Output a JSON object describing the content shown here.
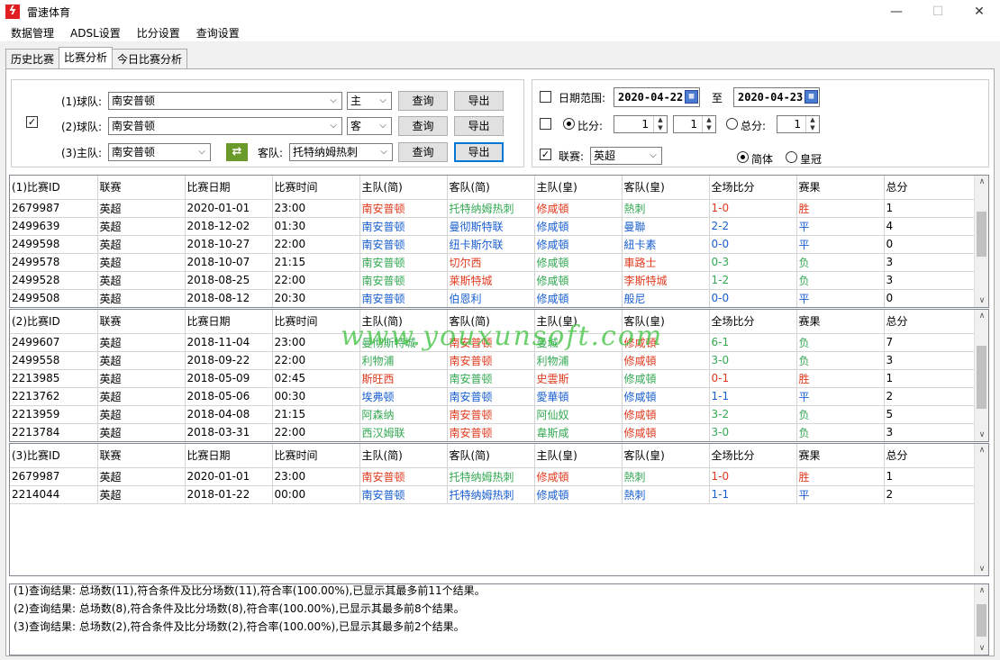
{
  "window": {
    "title": "雷速体育",
    "app_icon": "lightning-app-icon",
    "minimize": "—",
    "maximize": "☐",
    "close": "✕"
  },
  "menu": [
    "数据管理",
    "ADSL设置",
    "比分设置",
    "查询设置"
  ],
  "tabs": [
    "历史比赛",
    "比赛分析",
    "今日比赛分析"
  ],
  "active_tab": "比赛分析",
  "query": {
    "row1": {
      "label": "(1)球队:",
      "team": "南安普顿",
      "side": "主",
      "query_btn": "查询",
      "export_btn": "导出"
    },
    "row2": {
      "label": "(2)球队:",
      "team": "南安普顿",
      "side": "客",
      "query_btn": "查询",
      "export_btn": "导出"
    },
    "row3": {
      "label": "(3)主队:",
      "home": "南安普顿",
      "away_label": "客队:",
      "away": "托特纳姆热刺",
      "query_btn": "查询",
      "export_btn": "导出"
    },
    "checked": true
  },
  "filters": {
    "date_range_label": "日期范围:",
    "date_from": "2020-04-22",
    "to_label": "至",
    "date_to": "2020-04-23",
    "score_label": "比分:",
    "score_home": "1",
    "score_sep": ":",
    "score_away": "1",
    "total_label": "总分:",
    "total_value": "1",
    "league_label": "联赛:",
    "league": "英超",
    "simplified_label": "简体",
    "crown_label": "皇冠",
    "date_checked": false,
    "score_checked": false,
    "league_checked": true
  },
  "grid1": {
    "headers": [
      "(1)比赛ID",
      "联赛",
      "比赛日期",
      "比赛时间",
      "主队(简)",
      "客队(简)",
      "主队(皇)",
      "客队(皇)",
      "全场比分",
      "赛果",
      "总分"
    ],
    "rows": [
      [
        "2679987",
        "英超",
        "2020-01-01",
        "23:00",
        "南安普顿",
        "托特纳姆热刺",
        "修咸頓",
        "熱刺",
        "1-0",
        "胜",
        "1"
      ],
      [
        "2499639",
        "英超",
        "2018-12-02",
        "01:30",
        "南安普顿",
        "曼彻斯特联",
        "修咸頓",
        "曼聯",
        "2-2",
        "平",
        "4"
      ],
      [
        "2499598",
        "英超",
        "2018-10-27",
        "22:00",
        "南安普顿",
        "纽卡斯尔联",
        "修咸頓",
        "紐卡素",
        "0-0",
        "平",
        "0"
      ],
      [
        "2499578",
        "英超",
        "2018-10-07",
        "21:15",
        "南安普顿",
        "切尔西",
        "修咸頓",
        "車路士",
        "0-3",
        "负",
        "3"
      ],
      [
        "2499528",
        "英超",
        "2018-08-25",
        "22:00",
        "南安普顿",
        "莱斯特城",
        "修咸頓",
        "李斯特城",
        "1-2",
        "负",
        "3"
      ],
      [
        "2499508",
        "英超",
        "2018-08-12",
        "20:30",
        "南安普顿",
        "伯恩利",
        "修咸頓",
        "般尼",
        "0-0",
        "平",
        "0"
      ]
    ]
  },
  "grid2": {
    "headers": [
      "(2)比赛ID",
      "联赛",
      "比赛日期",
      "比赛时间",
      "主队(简)",
      "客队(简)",
      "主队(皇)",
      "客队(皇)",
      "全场比分",
      "赛果",
      "总分"
    ],
    "rows": [
      [
        "2499607",
        "英超",
        "2018-11-04",
        "23:00",
        "曼彻斯特城",
        "南安普顿",
        "曼城",
        "修咸頓",
        "6-1",
        "负",
        "7"
      ],
      [
        "2499558",
        "英超",
        "2018-09-22",
        "22:00",
        "利物浦",
        "南安普顿",
        "利物浦",
        "修咸頓",
        "3-0",
        "负",
        "3"
      ],
      [
        "2213985",
        "英超",
        "2018-05-09",
        "02:45",
        "斯旺西",
        "南安普顿",
        "史雲斯",
        "修咸頓",
        "0-1",
        "胜",
        "1"
      ],
      [
        "2213762",
        "英超",
        "2018-05-06",
        "00:30",
        "埃弗顿",
        "南安普顿",
        "愛華頓",
        "修咸頓",
        "1-1",
        "平",
        "2"
      ],
      [
        "2213959",
        "英超",
        "2018-04-08",
        "21:15",
        "阿森纳",
        "南安普顿",
        "阿仙奴",
        "修咸頓",
        "3-2",
        "负",
        "5"
      ],
      [
        "2213784",
        "英超",
        "2018-03-31",
        "22:00",
        "西汉姆联",
        "南安普顿",
        "韋斯咸",
        "修咸頓",
        "3-0",
        "负",
        "3"
      ]
    ]
  },
  "grid3": {
    "headers": [
      "(3)比赛ID",
      "联赛",
      "比赛日期",
      "比赛时间",
      "主队(简)",
      "客队(简)",
      "主队(皇)",
      "客队(皇)",
      "全场比分",
      "赛果",
      "总分"
    ],
    "rows": [
      [
        "2679987",
        "英超",
        "2020-01-01",
        "23:00",
        "南安普顿",
        "托特纳姆热刺",
        "修咸頓",
        "熱刺",
        "1-0",
        "胜",
        "1"
      ],
      [
        "2214044",
        "英超",
        "2018-01-22",
        "00:00",
        "南安普顿",
        "托特纳姆热刺",
        "修咸頓",
        "熱刺",
        "1-1",
        "平",
        "2"
      ]
    ]
  },
  "row_colors": {
    "grid1": [
      "red",
      "blue",
      "blue",
      "green",
      "green",
      "blue"
    ],
    "grid2": [
      "green",
      "green",
      "red",
      "blue",
      "green",
      "green"
    ],
    "grid3": [
      "red",
      "blue"
    ]
  },
  "colors": {
    "win": "#e03a1e",
    "draw": "#1a5fd0",
    "loss": "#34a853"
  },
  "log": [
    "(1)查询结果: 总场数(11),符合条件及比分场数(11),符合率(100.00%),已显示其最多前11个结果。",
    "(2)查询结果: 总场数(8),符合条件及比分场数(8),符合率(100.00%),已显示其最多前8个结果。",
    "(3)查询结果: 总场数(2),符合条件及比分场数(2),符合率(100.00%),已显示其最多前2个结果。"
  ],
  "watermark": "www.youxunsoft.com"
}
